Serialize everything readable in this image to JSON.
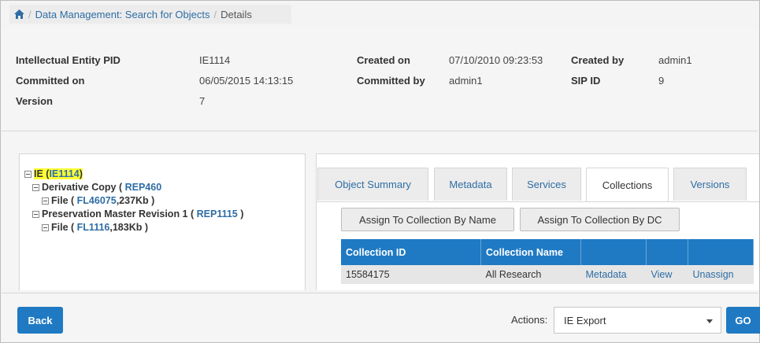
{
  "breadcrumb": {
    "home_icon": "home-icon",
    "link": "Data Management: Search for Objects",
    "current": "Details",
    "separator": "/"
  },
  "details": {
    "ie_pid_label": "Intellectual Entity PID",
    "ie_pid_value": "IE1114",
    "created_on_label": "Created on",
    "created_on_value": "07/10/2010 09:23:53",
    "created_by_label": "Created by",
    "created_by_value": "admin1",
    "committed_on_label": "Committed on",
    "committed_on_value": "06/05/2015 14:13:15",
    "committed_by_label": "Committed by",
    "committed_by_value": "admin1",
    "sip_id_label": "SIP ID",
    "sip_id_value": "9",
    "version_label": "Version",
    "version_value": "7"
  },
  "tree": {
    "ie": {
      "prefix": "IE (",
      "id": "IE1114",
      "suffix": ")"
    },
    "derivative": {
      "prefix": "Derivative Copy (",
      "id": "REP460"
    },
    "derivative_file": {
      "prefix": "File (",
      "id": "FL46075",
      "suffix": ",237Kb )"
    },
    "preservation": {
      "prefix": "Preservation Master Revision 1 (",
      "id": "REP1115",
      "suffix": ")"
    },
    "preservation_file": {
      "prefix": "File (",
      "id": "FL1116",
      "suffix": ",183Kb )"
    }
  },
  "tabs": [
    "Object Summary",
    "Metadata",
    "Services",
    "Collections",
    "Versions"
  ],
  "active_tab": "Collections",
  "buttons": {
    "assign_by_name": "Assign To Collection By Name",
    "assign_by_dc": "Assign To Collection By DC"
  },
  "collections_table": {
    "headers": [
      "Collection ID",
      "Collection Name",
      "",
      "",
      ""
    ],
    "rows": [
      {
        "id": "15584175",
        "name": "All Research",
        "metadata": "Metadata",
        "view": "View",
        "unassign": "Unassign"
      }
    ]
  },
  "footer": {
    "back": "Back",
    "actions_label": "Actions:",
    "actions_selected": "IE Export",
    "go": "GO"
  },
  "colors": {
    "primary": "#1f7ac3",
    "link": "#2e6da4",
    "highlight": "#ffff33"
  }
}
